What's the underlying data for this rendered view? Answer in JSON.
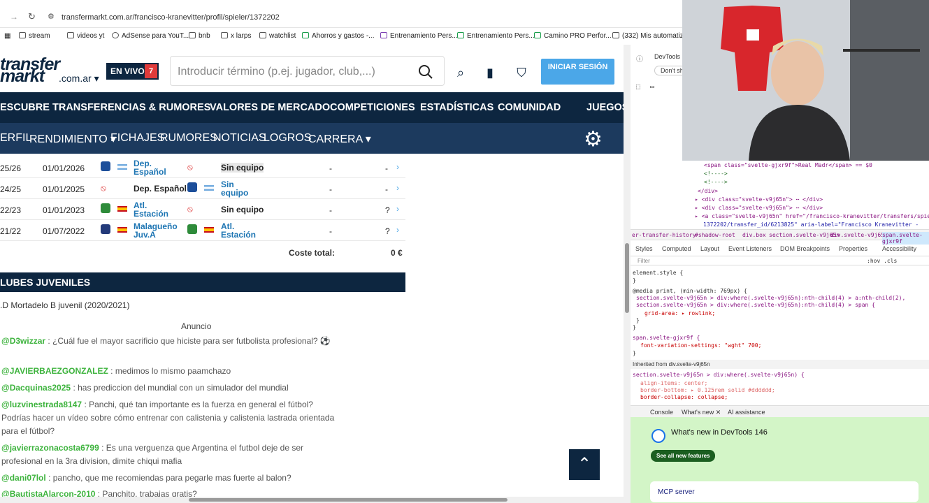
{
  "browser": {
    "url": "transfermarkt.com.ar/francisco-kranevitter/profil/spieler/1372202",
    "bookmarks": [
      "stream",
      "videos yt",
      "AdSense para YouT...",
      "bnb",
      "x larps",
      "watchlist",
      "Ahorros y gastos -...",
      "Entrenamiento Pers...",
      "Entrenamiento Pers...",
      "Camino PRO Perfor...",
      "(332) Mis automatiz..."
    ]
  },
  "site": {
    "logo_main": "transfer",
    "logo_sub": "markt",
    "logo_domain": ".com.ar",
    "live_label": "EN VIVO",
    "live_count": "7",
    "search_placeholder": "Introducir término (p.ej. jugador, club,...)",
    "login_label": "INICIAR SESIÓN",
    "nav": [
      "ESCUBRE",
      "TRANSFERENCIAS & RUMORES",
      "VALORES DE MERCADO",
      "COMPETICIONES",
      "ESTADÍSTICAS",
      "COMUNIDAD",
      "JUEGOS"
    ],
    "subnav": [
      "ERFIL",
      "RENDIMIENTO ▾",
      "FICHAJES",
      "RUMORES",
      "NOTICIAS",
      "LOGROS",
      "CARRERA ▾"
    ]
  },
  "transfers": [
    {
      "season": "25/26",
      "date": "01/01/2026",
      "from": "Dep. Español",
      "to": "Sin equipo",
      "value": "-",
      "fee": "-"
    },
    {
      "season": "24/25",
      "date": "01/01/2025",
      "from": "Sin equipo",
      "to": "Dep. Español",
      "value": "-",
      "fee": "-"
    },
    {
      "season": "22/23",
      "date": "01/01/2023",
      "from": "Atl. Estación",
      "to": "Sin equipo",
      "value": "-",
      "fee": "?"
    },
    {
      "season": "21/22",
      "date": "01/07/2022",
      "from": "Malagueño Juv.A",
      "to": "Atl. Estación",
      "value": "-",
      "fee": "?"
    }
  ],
  "cost_label": "Coste total:",
  "cost_value": "0 €",
  "youth_title": "LUBES JUVENILES",
  "youth_text": ".D Mortadelo B juvenil (2020/2021)",
  "ad_label": "Anuncio",
  "chat": [
    {
      "user": "@D3wizzar",
      "msg": ": ¿Cuál fue el mayor sacrificio que hiciste para ser futbolista profesional? ⚽"
    },
    {
      "user": "@JAVIERBAEZGONZALEZ",
      "msg": ": medimos lo mismo paamchazo"
    },
    {
      "user": "@Dacquinas2025",
      "msg": ": has prediccion del mundial con un simulador del mundial"
    },
    {
      "user": "@luzvinestrada8147",
      "msg": ": Panchi, qué tan importante es la fuerza en general el fútbol? Podrías hacer un vídeo sobre cómo entrenar con calistenia y calistenia lastrada orientada para el fútbol?"
    },
    {
      "user": "@javierrazonacosta6799",
      "msg": ": Es una verguenza que Argentina el futbol deje de ser profesional en la 3ra division, dimite chiqui mafia"
    },
    {
      "user": "@dani07lol",
      "msg": ": pancho, que me recomiendas para pegarle mas fuerte al balon?"
    },
    {
      "user": "@BautistaAlarcon-2010",
      "msg": ": Panchito, trabajas gratis?"
    }
  ],
  "devtools": {
    "title": "DevTools",
    "dont": "Don't sh",
    "tabs": [
      "Styles",
      "Computed",
      "Layout",
      "Event Listeners",
      "DOM Breakpoints",
      "Properties",
      "Accessibility"
    ],
    "filter": "Filter",
    "hov": ":hov .cls",
    "crumbs": [
      "er-transfer-history",
      "#shadow-root",
      "div.box",
      "section.svelte-v9j65n",
      "div.svelte-v9j65n",
      "span.svelte-gjxr9f"
    ],
    "drawer_tabs": [
      "Console",
      "What's new ✕",
      "AI assistance"
    ],
    "whatsnew_title": "What's new in DevTools 146",
    "whatsnew_btn": "See all new features",
    "mcp": "MCP server",
    "dom": [
      "<span class=\"svelte-gjxr9f\">Real Madr</span> == $0",
      "<!---->",
      "<!---->",
      "</div>",
      "▸ <div class=\"svelte-v9j65n\"> ⋯ </div>",
      "▸ <div class=\"svelte-v9j65n\"> ⋯ </div>",
      "▸ <a class=\"svelte-v9j65n\" href=\"/francisco-kranevitter/transfers/spieler/",
      "1372202/transfer_id/6213825\" aria-label=\"Francisco Kranevitter -"
    ],
    "css": [
      "element.style {",
      "}",
      "@media print, (min-width: 769px) {",
      "section.svelte-v9j65n > div:where(.svelte-v9j65n):nth-child(4) > a:nth-child(2),",
      "section.svelte-v9j65n > div:where(.svelte-v9j65n):nth-child(4) > span {",
      "grid-area: ▸ rowlink;",
      "}",
      "}",
      "span.svelte-gjxr9f {",
      "font-variation-settings: \"wght\" 700;",
      "}",
      "Inherited from div.svelte-v9j65n",
      "section.svelte-v9j65n > div:where(.svelte-v9j65n) {",
      "align-items: center;",
      "border-bottom: ▸ 0.125rem solid #dddddd;",
      "border-collapse: collapse;"
    ]
  }
}
